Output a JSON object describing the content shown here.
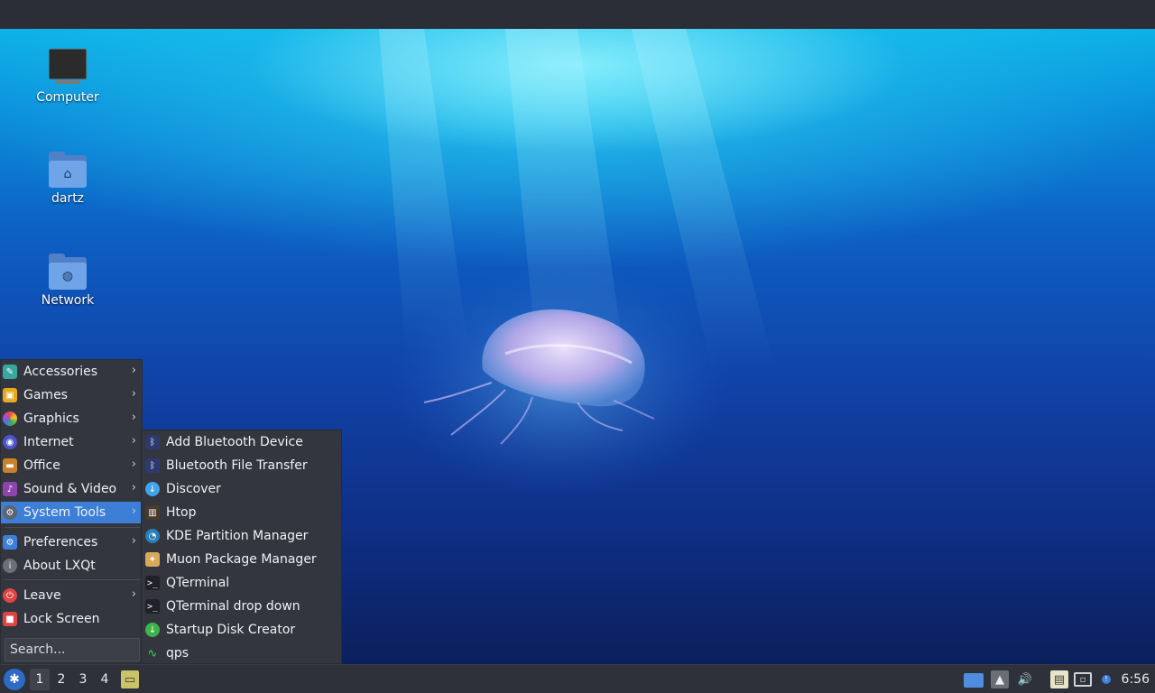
{
  "desktop": {
    "icons": [
      {
        "label": "Computer",
        "icon": "computer-icon"
      },
      {
        "label": "dartz",
        "icon": "home-folder-icon"
      },
      {
        "label": "Network",
        "icon": "network-folder-icon"
      }
    ]
  },
  "menu": {
    "categories": [
      {
        "label": "Accessories",
        "icon": "accessories-icon",
        "has_submenu": true
      },
      {
        "label": "Games",
        "icon": "games-icon",
        "has_submenu": true
      },
      {
        "label": "Graphics",
        "icon": "graphics-icon",
        "has_submenu": true
      },
      {
        "label": "Internet",
        "icon": "internet-icon",
        "has_submenu": true
      },
      {
        "label": "Office",
        "icon": "office-icon",
        "has_submenu": true
      },
      {
        "label": "Sound & Video",
        "icon": "sound-video-icon",
        "has_submenu": true
      },
      {
        "label": "System Tools",
        "icon": "system-tools-icon",
        "has_submenu": true,
        "active": true
      }
    ],
    "preferences": {
      "label": "Preferences",
      "icon": "preferences-icon"
    },
    "about": {
      "label": "About LXQt",
      "icon": "info-icon"
    },
    "leave": {
      "label": "Leave",
      "icon": "power-icon"
    },
    "lock": {
      "label": "Lock Screen",
      "icon": "lock-icon"
    },
    "search_placeholder": "Search..."
  },
  "submenu": {
    "items": [
      {
        "label": "Add Bluetooth Device",
        "icon": "bluetooth-icon"
      },
      {
        "label": "Bluetooth File Transfer",
        "icon": "bluetooth-icon"
      },
      {
        "label": "Discover",
        "icon": "discover-icon"
      },
      {
        "label": "Htop",
        "icon": "htop-icon"
      },
      {
        "label": "KDE Partition Manager",
        "icon": "partition-manager-icon"
      },
      {
        "label": "Muon Package Manager",
        "icon": "package-manager-icon"
      },
      {
        "label": "QTerminal",
        "icon": "terminal-icon"
      },
      {
        "label": "QTerminal drop down",
        "icon": "terminal-icon"
      },
      {
        "label": "Startup Disk Creator",
        "icon": "startup-disk-icon"
      },
      {
        "label": "qps",
        "icon": "qps-icon"
      }
    ]
  },
  "taskbar": {
    "workspaces": [
      "1",
      "2",
      "3",
      "4"
    ],
    "current_workspace": "1",
    "clock": "6:56"
  },
  "colors": {
    "menu_bg": "#33363e",
    "highlight": "#3d7fd6",
    "taskbar_bg": "#2e3139"
  }
}
